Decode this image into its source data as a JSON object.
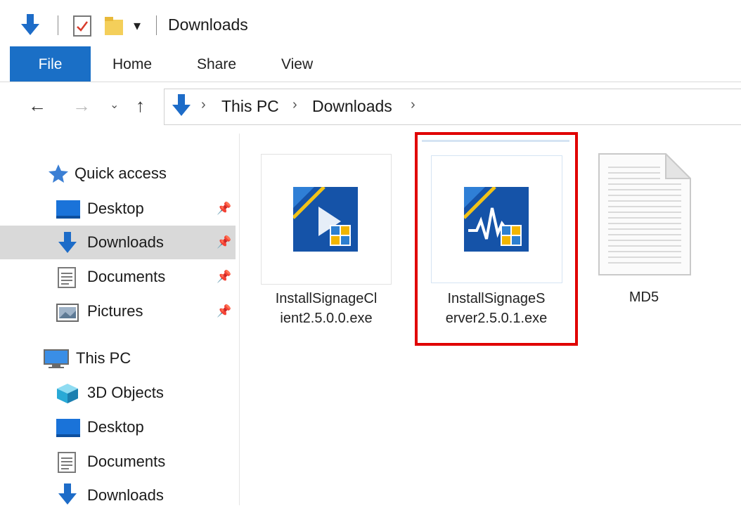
{
  "window": {
    "title": "Downloads",
    "quick_access_icons": [
      "download-arrow-icon",
      "properties-check-icon",
      "new-folder-icon",
      "customize-dropdown-icon"
    ]
  },
  "ribbon": {
    "tabs": [
      {
        "label": "File",
        "active": true
      },
      {
        "label": "Home"
      },
      {
        "label": "Share"
      },
      {
        "label": "View"
      }
    ],
    "accent_color": "#1a6fc6"
  },
  "address": {
    "crumbs": [
      "This PC",
      "Downloads"
    ]
  },
  "nav": {
    "quick_access": {
      "label": "Quick access",
      "items": [
        {
          "label": "Desktop",
          "icon": "desktop-icon",
          "pinned": true
        },
        {
          "label": "Downloads",
          "icon": "downloads-icon",
          "pinned": true,
          "selected": true
        },
        {
          "label": "Documents",
          "icon": "documents-icon",
          "pinned": true
        },
        {
          "label": "Pictures",
          "icon": "pictures-icon",
          "pinned": true
        }
      ]
    },
    "this_pc": {
      "label": "This PC",
      "items": [
        {
          "label": "3D Objects",
          "icon": "3d-objects-icon"
        },
        {
          "label": "Desktop",
          "icon": "desktop-icon"
        },
        {
          "label": "Documents",
          "icon": "documents-icon"
        },
        {
          "label": "Downloads",
          "icon": "downloads-icon"
        }
      ]
    }
  },
  "files": [
    {
      "line1": "InstallSignageCl",
      "line2": "ient2.5.0.0.exe",
      "icon": "signage-client-installer-icon"
    },
    {
      "line1": "InstallSignageS",
      "line2": "erver2.5.0.1.exe",
      "icon": "signage-server-installer-icon",
      "highlighted": true,
      "highlight_color": "#e00000"
    },
    {
      "line1": "MD5",
      "line2": "",
      "icon": "text-document-icon"
    }
  ]
}
